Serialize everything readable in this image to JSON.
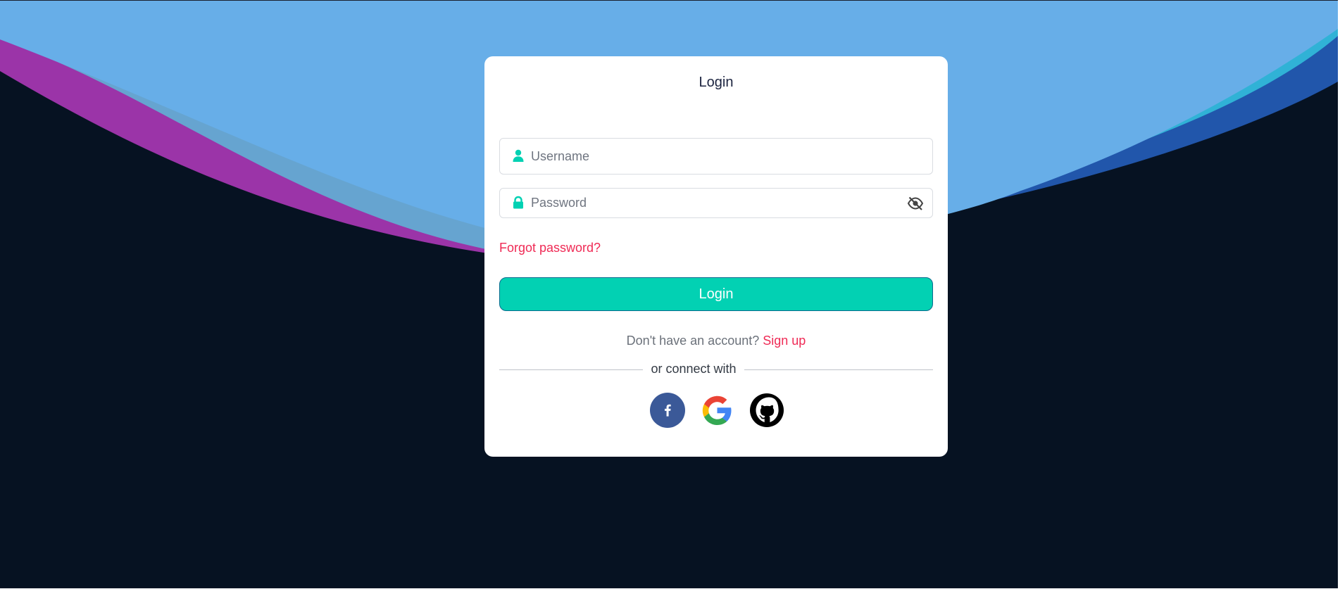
{
  "login_card": {
    "title": "Login",
    "username_placeholder": "Username",
    "password_placeholder": "Password",
    "forgot_password": "Forgot password?",
    "login_button": "Login",
    "no_account_text": "Don't have an account?",
    "signup_link": "Sign up",
    "divider_text": "or connect with"
  },
  "icons": {
    "username": "user-icon",
    "password": "lock-icon",
    "toggle_visibility": "eye-slash-icon",
    "social": [
      "facebook-icon",
      "google-icon",
      "github-icon"
    ]
  },
  "colors": {
    "background": "#061222",
    "wave_light_blue": "#67aee8",
    "accent_teal": "#02d1b3",
    "link_red": "#ef2a55",
    "facebook_blue": "#3b5998"
  }
}
